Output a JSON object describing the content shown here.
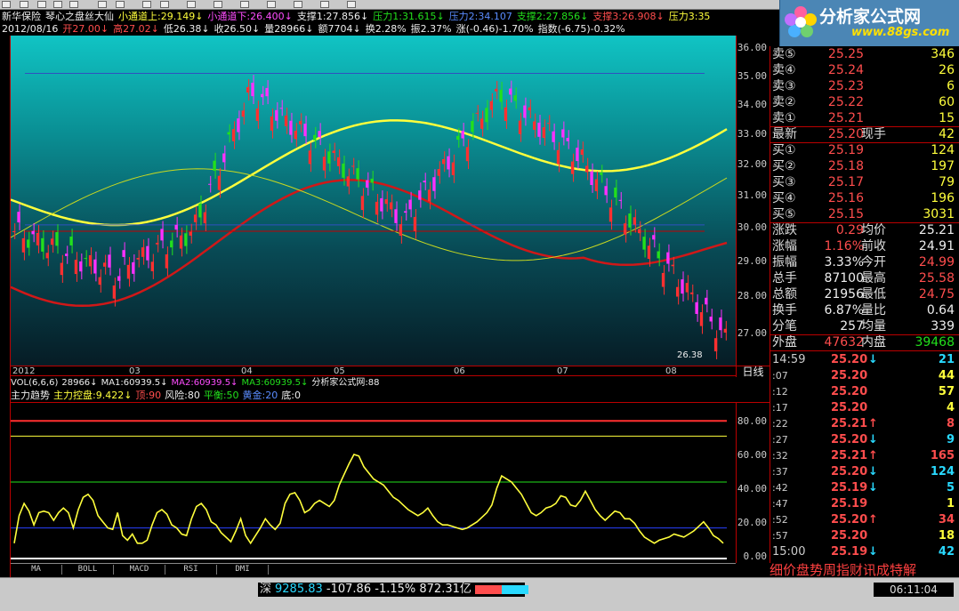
{
  "header": {
    "stock_name": "新华保险",
    "indicator_name": "琴心之盘丝大仙",
    "line1": [
      {
        "text": "小通道上:29.149↓",
        "color": "#ffff3c"
      },
      {
        "text": "小通道下:26.400↓",
        "color": "#ff4dff"
      },
      {
        "text": "支撑1:27.856↓",
        "color": "#eeeeee"
      },
      {
        "text": "压力1:31.615↓",
        "color": "#22e01c"
      },
      {
        "text": "压力2:34.107",
        "color": "#5a8cff"
      },
      {
        "text": "支撑2:27.856↓",
        "color": "#22e01c"
      },
      {
        "text": "支撑3:26.908↓",
        "color": "#ff4d4d"
      },
      {
        "text": "压力3:35",
        "color": "#ffff3c"
      }
    ],
    "line2": [
      {
        "text": "2012/08/16",
        "color": "#eeeeee"
      },
      {
        "text": "开27.00↓",
        "color": "#ff4d4d"
      },
      {
        "text": "高27.02↓",
        "color": "#ff4d4d"
      },
      {
        "text": "低26.38↓",
        "color": "#eeeeee"
      },
      {
        "text": "收26.50↓",
        "color": "#eeeeee"
      },
      {
        "text": "量28966↓",
        "color": "#eeeeee"
      },
      {
        "text": "额7704↓",
        "color": "#eeeeee"
      },
      {
        "text": "换2.28%",
        "color": "#eeeeee"
      },
      {
        "text": "振2.37%",
        "color": "#eeeeee"
      },
      {
        "text": "涨(-0.46)-1.70%",
        "color": "#eeeeee"
      },
      {
        "text": "指数(-6.75)-0.32%",
        "color": "#eeeeee"
      }
    ]
  },
  "logo": {
    "name": "分析家公式网",
    "url": "www.88gs.com"
  },
  "price_scale": [
    "36.00",
    "35.00",
    "34.00",
    "33.00",
    "32.00",
    "31.00",
    "30.00",
    "29.00",
    "28.00",
    "27.00"
  ],
  "last_low_label": "26.38",
  "dates": [
    "2012",
    "03",
    "04",
    "05",
    "06",
    "07",
    "08"
  ],
  "period_label": "日线",
  "volume_row": [
    {
      "text": "VOL(6,6,6)",
      "color": "#eeeeee"
    },
    {
      "text": "28966↓",
      "color": "#eeeeee"
    },
    {
      "text": "MA1:60939.5↓",
      "color": "#eeeeee"
    },
    {
      "text": "MA2:60939.5↓",
      "color": "#ff4dff"
    },
    {
      "text": "MA3:60939.5↓",
      "color": "#22e01c"
    },
    {
      "text": "分析家公式网:88",
      "color": "#eeeeee"
    }
  ],
  "indicator_row": [
    {
      "text": "主力趋势",
      "color": "#eeeeee"
    },
    {
      "text": "主力控盘:9.422↓",
      "color": "#ffff3c"
    },
    {
      "text": "顶:90",
      "color": "#ff4d4d"
    },
    {
      "text": "风险:80",
      "color": "#eeeeee"
    },
    {
      "text": "平衡:50",
      "color": "#22e01c"
    },
    {
      "text": "黄金:20",
      "color": "#5a8cff"
    },
    {
      "text": "底:0",
      "color": "#eeeeee"
    }
  ],
  "indicator_scale": [
    "80.00",
    "60.00",
    "40.00",
    "20.00",
    "0.00"
  ],
  "chart_data": {
    "type": "line",
    "title": "主力控盘",
    "ylim": [
      0,
      100
    ],
    "series": [
      {
        "name": "主力控盘",
        "values": [
          10,
          28,
          36,
          31,
          22,
          30,
          31,
          30,
          25,
          30,
          33,
          30,
          20,
          32,
          40,
          42,
          38,
          28,
          24,
          20,
          19,
          30,
          15,
          12,
          16,
          10,
          10,
          12,
          22,
          30,
          32,
          29,
          22,
          20,
          16,
          15,
          26,
          34,
          36,
          32,
          24,
          22,
          17,
          14,
          11,
          18,
          26,
          15,
          10,
          15,
          20,
          26,
          22,
          19,
          23,
          36,
          42,
          43,
          38,
          30,
          32,
          36,
          38,
          36,
          34,
          38,
          48,
          55,
          62,
          68,
          67,
          60,
          56,
          52,
          50,
          48,
          44,
          40,
          38,
          35,
          32,
          30,
          28,
          30,
          33,
          28,
          24,
          22,
          22,
          21,
          20,
          19,
          20,
          22,
          24,
          27,
          30,
          35,
          46,
          54,
          52,
          50,
          46,
          42,
          36,
          30,
          28,
          30,
          33,
          34,
          36,
          41,
          40,
          35,
          34,
          38,
          44,
          38,
          32,
          28,
          25,
          28,
          31,
          30,
          26,
          26,
          23,
          18,
          14,
          12,
          10,
          12,
          13,
          14,
          16,
          15,
          14,
          16,
          18,
          21,
          24,
          20,
          15,
          13,
          10
        ]
      }
    ],
    "reference_lines": {
      "顶": 90,
      "风险": 80,
      "平衡": 50,
      "黄金": 20,
      "底": 0
    }
  },
  "order_book": {
    "sells": [
      {
        "label": "卖⑤",
        "price": "25.25",
        "vol": "346"
      },
      {
        "label": "卖④",
        "price": "25.24",
        "vol": "26"
      },
      {
        "label": "卖③",
        "price": "25.23",
        "vol": "6"
      },
      {
        "label": "卖②",
        "price": "25.22",
        "vol": "60"
      },
      {
        "label": "卖①",
        "price": "25.21",
        "vol": "15"
      }
    ],
    "latest": {
      "label": "最新",
      "price": "25.20",
      "label2": "现手",
      "vol": "42"
    },
    "buys": [
      {
        "label": "买①",
        "price": "25.19",
        "vol": "124"
      },
      {
        "label": "买②",
        "price": "25.18",
        "vol": "197"
      },
      {
        "label": "买③",
        "price": "25.17",
        "vol": "79"
      },
      {
        "label": "买④",
        "price": "25.16",
        "vol": "196"
      },
      {
        "label": "买⑤",
        "price": "25.15",
        "vol": "3031"
      }
    ]
  },
  "stats": [
    {
      "l1": "涨跌",
      "v1": "0.29",
      "c1": "#ff4d4d",
      "l2": "均价",
      "v2": "25.21",
      "c2": "#eeeeee"
    },
    {
      "l1": "涨幅",
      "v1": "1.16%",
      "c1": "#ff4d4d",
      "l2": "前收",
      "v2": "24.91",
      "c2": "#eeeeee"
    },
    {
      "l1": "振幅",
      "v1": "3.33%",
      "c1": "#eeeeee",
      "l2": "今开",
      "v2": "24.99",
      "c2": "#ff4d4d"
    },
    {
      "l1": "总手",
      "v1": "87100",
      "c1": "#eeeeee",
      "l2": "最高",
      "v2": "25.58",
      "c2": "#ff4d4d"
    },
    {
      "l1": "总额",
      "v1": "21956",
      "c1": "#eeeeee",
      "l2": "最低",
      "v2": "24.75",
      "c2": "#ff4d4d"
    },
    {
      "l1": "换手",
      "v1": "6.87%",
      "c1": "#eeeeee",
      "l2": "量比",
      "v2": "0.64",
      "c2": "#eeeeee"
    },
    {
      "l1": "分笔",
      "v1": "257",
      "c1": "#eeeeee",
      "l2": "均量",
      "v2": "339",
      "c2": "#eeeeee"
    }
  ],
  "outer_inner": {
    "l1": "外盘",
    "v1": "47632",
    "l2": "内盘",
    "v2": "39468"
  },
  "ticks": [
    {
      "t": "14:59",
      "p": "25.20",
      "dir": "down",
      "q": "21"
    },
    {
      "t": ":07",
      "p": "25.20",
      "dir": "none",
      "q": "44"
    },
    {
      "t": ":12",
      "p": "25.20",
      "dir": "none",
      "q": "57"
    },
    {
      "t": ":17",
      "p": "25.20",
      "dir": "none",
      "q": "4"
    },
    {
      "t": ":22",
      "p": "25.21",
      "dir": "up",
      "q": "8"
    },
    {
      "t": ":27",
      "p": "25.20",
      "dir": "down",
      "q": "9"
    },
    {
      "t": ":32",
      "p": "25.21",
      "dir": "up",
      "q": "165"
    },
    {
      "t": ":37",
      "p": "25.20",
      "dir": "down",
      "q": "124"
    },
    {
      "t": ":42",
      "p": "25.19",
      "dir": "down",
      "q": "5"
    },
    {
      "t": ":47",
      "p": "25.19",
      "dir": "none",
      "q": "1"
    },
    {
      "t": ":52",
      "p": "25.20",
      "dir": "up",
      "q": "34"
    },
    {
      "t": ":57",
      "p": "25.20",
      "dir": "none",
      "q": "18"
    },
    {
      "t": "15:00",
      "p": "25.19",
      "dir": "down",
      "q": "42"
    }
  ],
  "bottom_tabs": [
    "MA",
    "BOLL",
    "MACD",
    "RSI",
    "DMI"
  ],
  "fn_keys": "细价盘势周指财讯成特解",
  "status": {
    "market": "深",
    "index": "9285.83",
    "change": "-107.86",
    "pct": "-1.15%",
    "amount": "872.31亿",
    "time": "06:11:04"
  },
  "colors": {
    "up": "#ff4d4d",
    "down": "#22e01c",
    "accent": "#ffff3c",
    "grid": "#b00000"
  }
}
